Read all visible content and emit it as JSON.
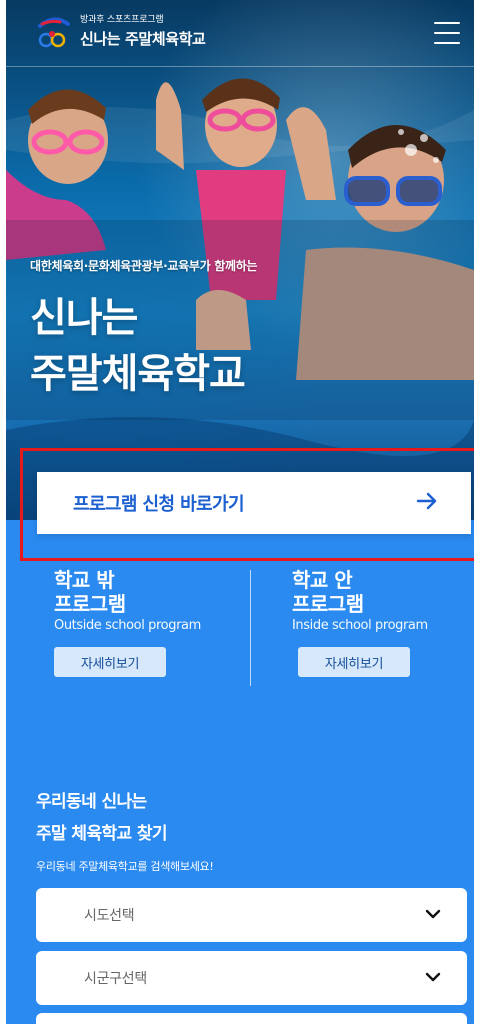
{
  "header": {
    "brand_small": "방과후 스포츠프로그램",
    "brand_title": "신나는 주말체육학교"
  },
  "hero": {
    "subtitle": "대한체육회·문화체육관광부·교육부가 함께하는",
    "title_line1": "신나는",
    "title_line2": "주말체육학교"
  },
  "cta": {
    "label": "프로그램 신청 바로가기",
    "highlight_color": "#e6191b"
  },
  "programs": [
    {
      "title_line1": "학교 밖",
      "title_line2": "프로그램",
      "english": "Outside school program",
      "button": "자세히보기"
    },
    {
      "title_line1": "학교 안",
      "title_line2": "프로그램",
      "english": "Inside school program",
      "button": "자세히보기"
    }
  ],
  "search": {
    "title_line1": "우리동네 신나는",
    "title_line2": "주말 체육학교 찾기",
    "description": "우리동네 주말체육학교를 검색해보세요!",
    "selects": [
      {
        "value": "시도선택"
      },
      {
        "value": "시군구선택"
      },
      {
        "value": ""
      }
    ]
  },
  "colors": {
    "background": "#2a8af0",
    "cta_text": "#1b5fd0",
    "detail_button_bg": "#d8e8fb"
  }
}
